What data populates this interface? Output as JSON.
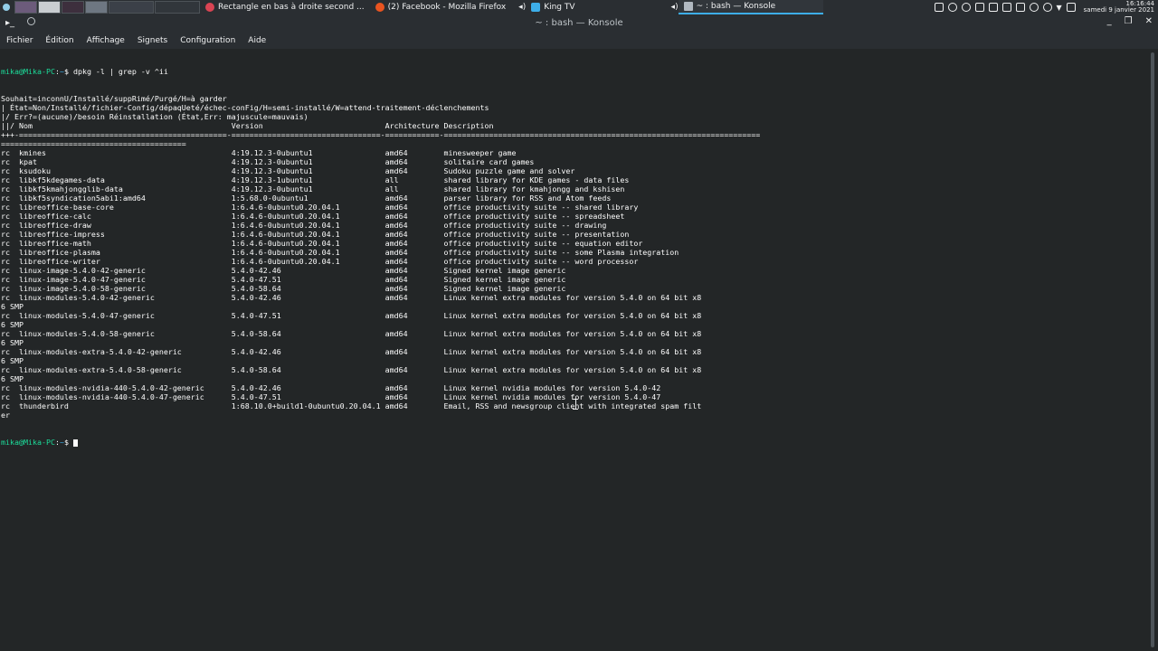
{
  "taskbar": {
    "tasks": [
      {
        "label": "Rectangle en bas à droite second ...",
        "icon": "spectacle-icon"
      },
      {
        "label": "(2) Facebook - Mozilla Firefox",
        "icon": "firefox-icon"
      },
      {
        "label": "King TV",
        "icon": "app-icon"
      },
      {
        "label": "~ : bash — Konsole",
        "icon": "konsole-icon"
      }
    ],
    "clock_time": "16:16:44",
    "clock_date": "samedi 9 janvier 2021"
  },
  "window": {
    "title": "~ : bash — Konsole",
    "menu": [
      "Fichier",
      "Édition",
      "Affichage",
      "Signets",
      "Configuration",
      "Aide"
    ]
  },
  "terminal": {
    "prompt_user": "mika@Mika-PC",
    "prompt_path": "~",
    "command": "dpkg -l | grep -v ^ii",
    "lines": [
      "Souhait=inconnU/Installé/suppRimé/Purgé/H=à garder",
      "| État=Non/Installé/fichier-Config/dépaqUeté/échec-conFig/H=semi-installé/W=attend-traitement-déclenchements",
      "|/ Err?=(aucune)/besoin Réinstallation (État,Err: majuscule=mauvais)",
      "||/ Nom                                            Version                           Architecture Description",
      "+++-==============================================-=================================-============-======================================================================",
      "=========================================",
      "rc  kmines                                         4:19.12.3-0ubuntu1                amd64        minesweeper game",
      "rc  kpat                                           4:19.12.3-0ubuntu1                amd64        solitaire card games",
      "rc  ksudoku                                        4:19.12.3-0ubuntu1                amd64        Sudoku puzzle game and solver",
      "rc  libkf5kdegames-data                            4:19.12.3-1ubuntu1                all          shared library for KDE games - data files",
      "rc  libkf5kmahjongglib-data                        4:19.12.3-0ubuntu1                all          shared library for kmahjongg and kshisen",
      "rc  libkf5syndication5abi1:amd64                   1:5.68.0-0ubuntu1                 amd64        parser library for RSS and Atom feeds",
      "rc  libreoffice-base-core                          1:6.4.6-0ubuntu0.20.04.1          amd64        office productivity suite -- shared library",
      "rc  libreoffice-calc                               1:6.4.6-0ubuntu0.20.04.1          amd64        office productivity suite -- spreadsheet",
      "rc  libreoffice-draw                               1:6.4.6-0ubuntu0.20.04.1          amd64        office productivity suite -- drawing",
      "rc  libreoffice-impress                            1:6.4.6-0ubuntu0.20.04.1          amd64        office productivity suite -- presentation",
      "rc  libreoffice-math                               1:6.4.6-0ubuntu0.20.04.1          amd64        office productivity suite -- equation editor",
      "rc  libreoffice-plasma                             1:6.4.6-0ubuntu0.20.04.1          amd64        office productivity suite -- some Plasma integration",
      "rc  libreoffice-writer                             1:6.4.6-0ubuntu0.20.04.1          amd64        office productivity suite -- word processor",
      "rc  linux-image-5.4.0-42-generic                   5.4.0-42.46                       amd64        Signed kernel image generic",
      "rc  linux-image-5.4.0-47-generic                   5.4.0-47.51                       amd64        Signed kernel image generic",
      "rc  linux-image-5.4.0-58-generic                   5.4.0-58.64                       amd64        Signed kernel image generic",
      "rc  linux-modules-5.4.0-42-generic                 5.4.0-42.46                       amd64        Linux kernel extra modules for version 5.4.0 on 64 bit x8",
      "6 SMP",
      "rc  linux-modules-5.4.0-47-generic                 5.4.0-47.51                       amd64        Linux kernel extra modules for version 5.4.0 on 64 bit x8",
      "6 SMP",
      "rc  linux-modules-5.4.0-58-generic                 5.4.0-58.64                       amd64        Linux kernel extra modules for version 5.4.0 on 64 bit x8",
      "6 SMP",
      "rc  linux-modules-extra-5.4.0-42-generic           5.4.0-42.46                       amd64        Linux kernel extra modules for version 5.4.0 on 64 bit x8",
      "6 SMP",
      "rc  linux-modules-extra-5.4.0-58-generic           5.4.0-58.64                       amd64        Linux kernel extra modules for version 5.4.0 on 64 bit x8",
      "6 SMP",
      "rc  linux-modules-nvidia-440-5.4.0-42-generic      5.4.0-42.46                       amd64        Linux kernel nvidia modules for version 5.4.0-42",
      "rc  linux-modules-nvidia-440-5.4.0-47-generic      5.4.0-47.51                       amd64        Linux kernel nvidia modules for version 5.4.0-47",
      "rc  thunderbird                                    1:68.10.0+build1-0ubuntu0.20.04.1 amd64        Email, RSS and newsgroup client with integrated spam filt",
      "er"
    ]
  }
}
